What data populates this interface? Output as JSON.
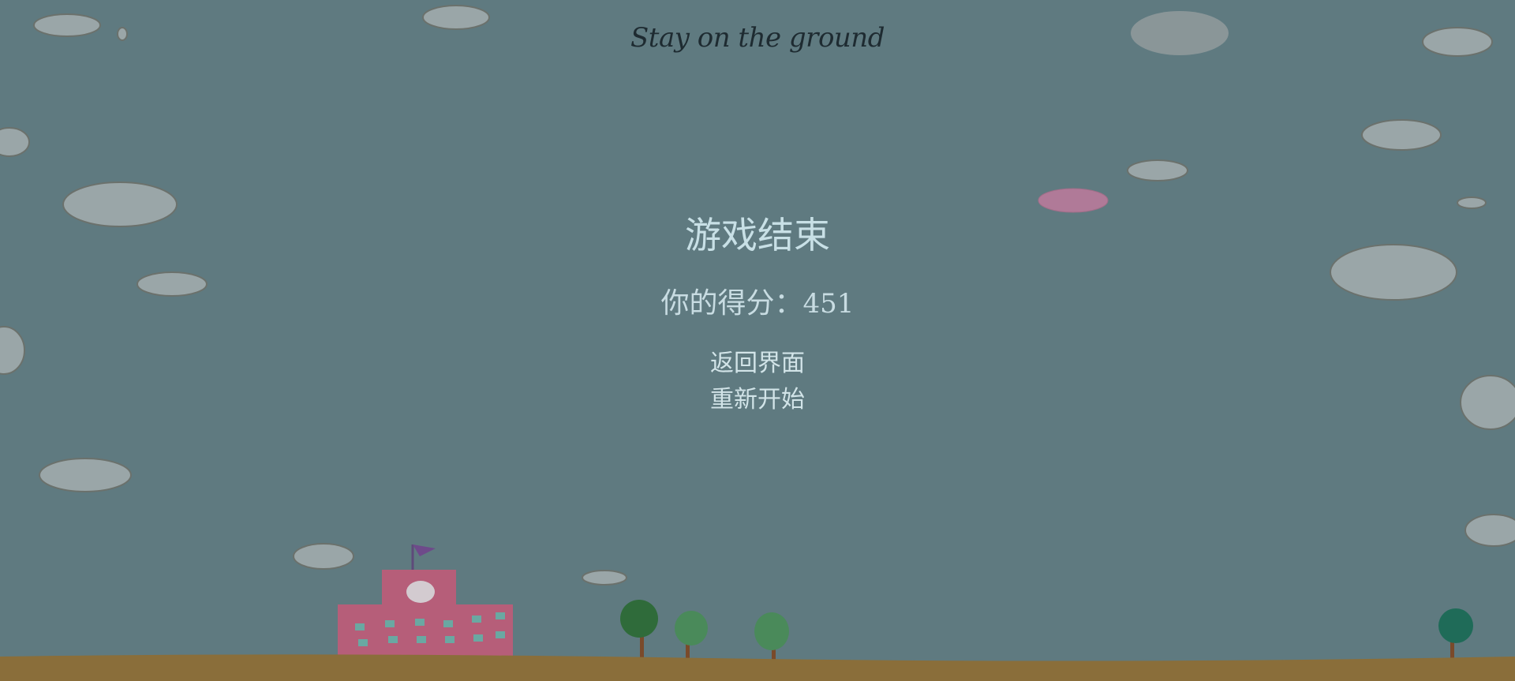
{
  "game": {
    "title": "Stay on the ground",
    "game_over_text": "游戏结束",
    "score_label": "你的得分：",
    "score_value": "451"
  },
  "menu": {
    "back_label": "返回界面",
    "restart_label": "重新开始"
  },
  "colors": {
    "overlay_sky": "#5f7a80",
    "ground": "#8a6e3a",
    "cloud": "#9aa6a8",
    "pink_cloud": "#b07a98",
    "school": "#b65e79",
    "tree_green": "#3f7a45"
  }
}
